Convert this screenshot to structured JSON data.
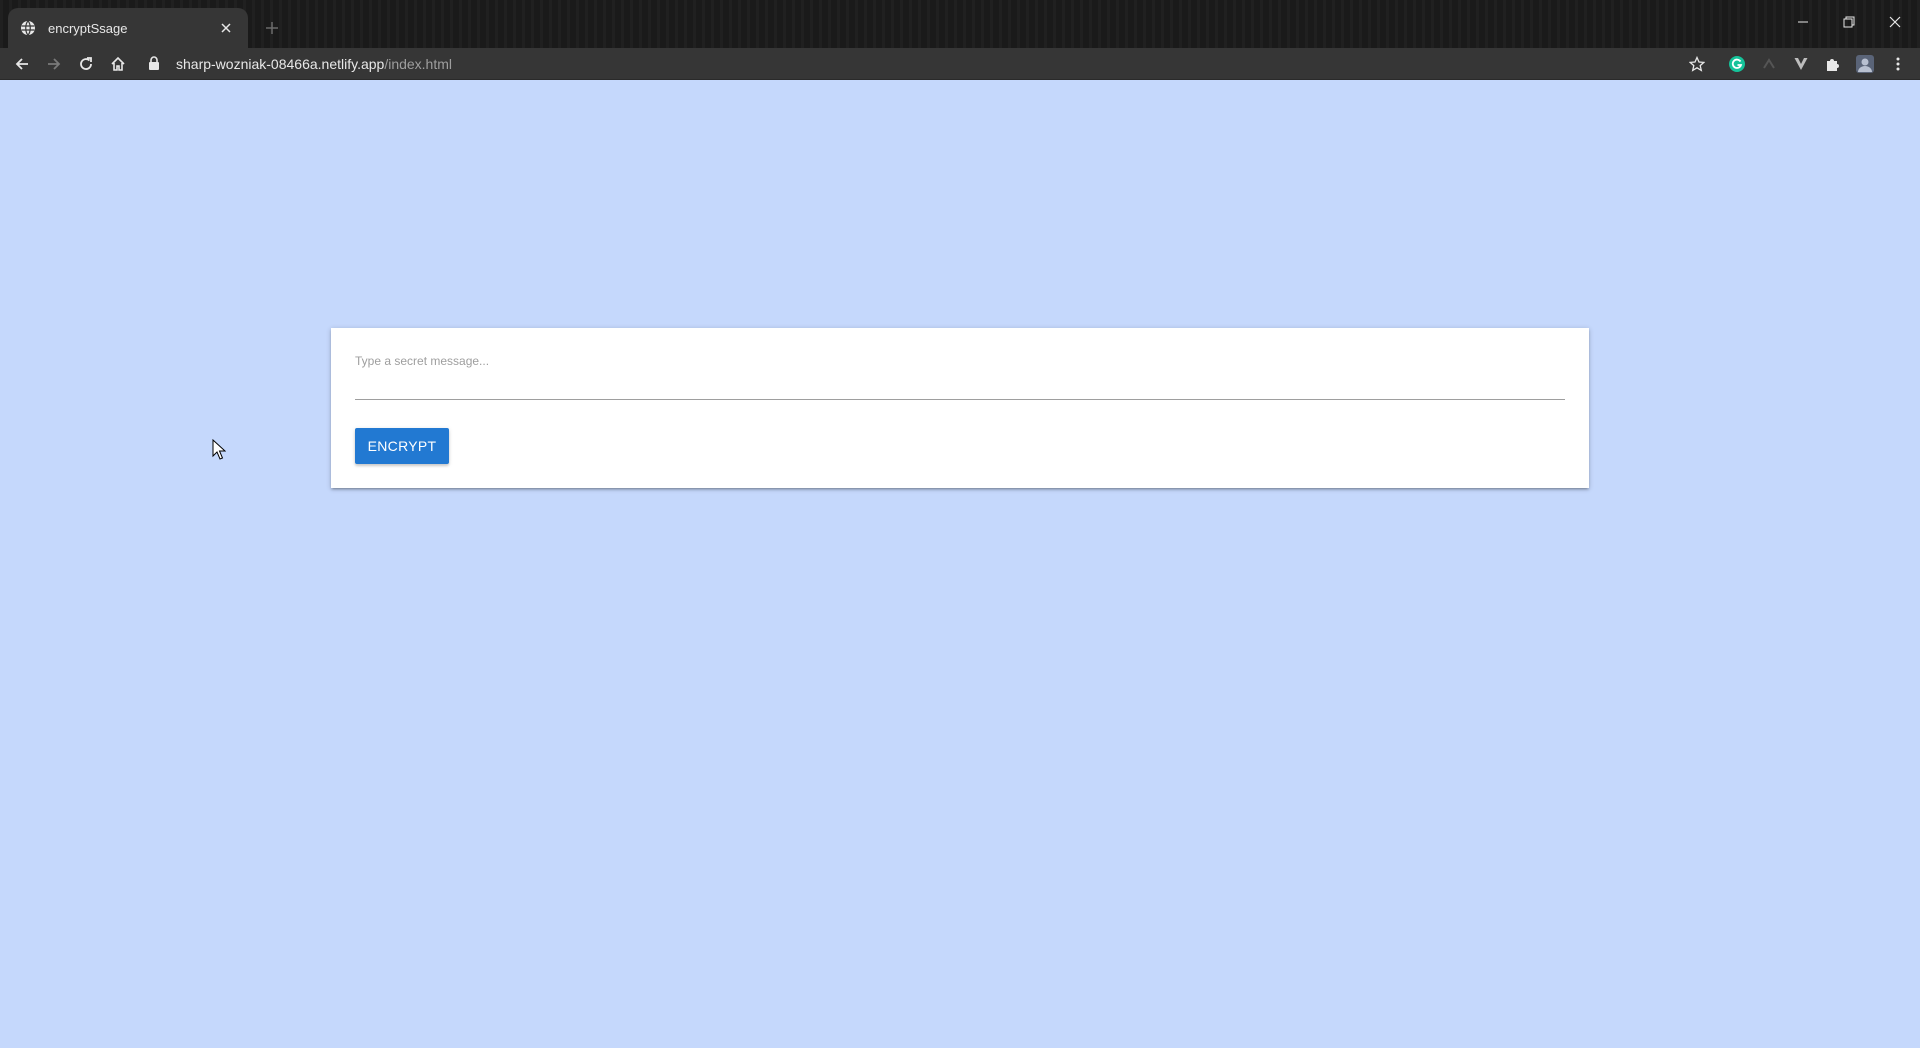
{
  "browser": {
    "tab": {
      "title": "encryptSsage",
      "favicon": "globe-icon"
    },
    "address": {
      "host": "sharp-wozniak-08466a.netlify.app",
      "path": "/index.html"
    },
    "icons": [
      "back-arrow-icon",
      "forward-arrow-icon",
      "reload-icon",
      "home-icon",
      "lock-icon",
      "star-icon",
      "grammarly-extension-icon",
      "extension-icon",
      "vuetify-extension-icon",
      "puzzle-extensions-icon",
      "profile-avatar-icon",
      "kebab-menu-icon"
    ],
    "colors": {
      "chrome_dark": "#1b1b1b",
      "toolbar": "#363636",
      "grammarly": "#15c39a"
    }
  },
  "page": {
    "background": "#c5d8fc",
    "form": {
      "message_placeholder": "Type a secret message...",
      "message_value": "",
      "encrypt_label": "ENCRYPT",
      "button_color": "#2279d2"
    }
  }
}
